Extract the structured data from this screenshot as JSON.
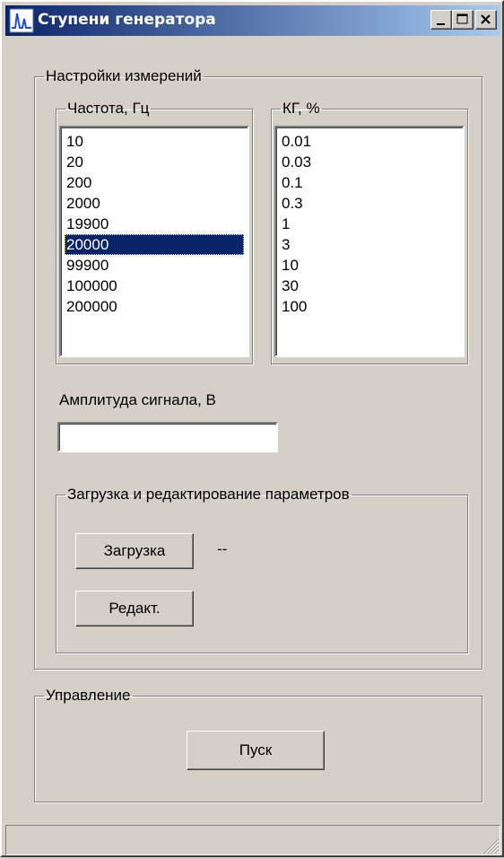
{
  "window": {
    "title": "Ступени генератора",
    "icon": "waveform-app-icon",
    "controls": [
      "minimize-icon",
      "maximize-icon",
      "close-icon"
    ]
  },
  "settings": {
    "legend": "Настройки измерений",
    "frequency": {
      "legend": "Частота, Гц",
      "items": [
        "10",
        "20",
        "200",
        "2000",
        "19900",
        "20000",
        "99900",
        "100000",
        "200000"
      ],
      "selected": "20000"
    },
    "thd": {
      "legend": "КГ, %",
      "items": [
        "0.01",
        "0.03",
        "0.1",
        "0.3",
        "1",
        "3",
        "10",
        "30",
        "100"
      ]
    },
    "amplitude": {
      "label": "Амплитуда сигнала, В",
      "value": ""
    },
    "params": {
      "legend": "Загрузка и редактирование параметров",
      "load_label": "Загрузка",
      "load_status": "--",
      "edit_label": "Редакт."
    }
  },
  "control": {
    "legend": "Управление",
    "start_label": "Пуск"
  },
  "colors": {
    "face": "#d4d0c8",
    "title_start": "#0a246a",
    "title_end": "#a6caf0",
    "selection": "#0a246a"
  }
}
